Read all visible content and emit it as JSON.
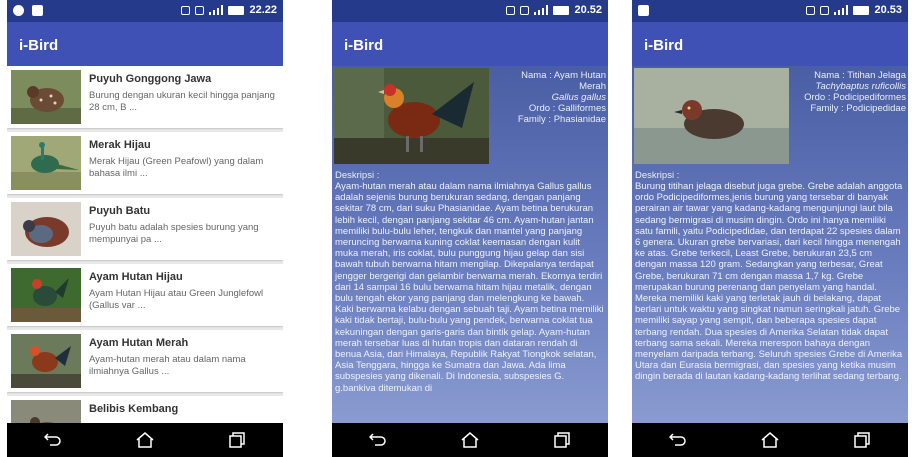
{
  "status": {
    "screen1_time": "22.22",
    "screen2_time": "20.52",
    "screen3_time": "20.53"
  },
  "app": {
    "title": "i-Bird"
  },
  "list": [
    {
      "title": "Puyuh Gonggong Jawa",
      "desc": "Burung dengan ukuran kecil hingga panjang 28 cm, B ..."
    },
    {
      "title": "Merak Hijau",
      "desc": "Merak Hijau (Green Peafowl) yang dalam bahasa ilmi ..."
    },
    {
      "title": "Puyuh Batu",
      "desc": "Puyuh batu adalah spesies burung yang mempunyai pa ..."
    },
    {
      "title": "Ayam Hutan Hijau",
      "desc": "Ayam Hutan Hijau atau Green Junglefowl (Gallus var ..."
    },
    {
      "title": "Ayam Hutan Merah",
      "desc": "Ayam-hutan merah atau dalam nama ilmiahnya Gallus ..."
    },
    {
      "title": "Belibis Kembang",
      "desc": ""
    }
  ],
  "detail_ayam": {
    "nama": "Nama : Ayam Hutan Merah",
    "latin": "Gallus gallus",
    "ordo": "Ordo : Galliformes",
    "family": "Family : Phasianidae",
    "desc_label": "Deskripsi :",
    "desc": "Ayam-hutan merah atau dalam nama ilmiahnya Gallus gallus adalah sejenis burung berukuran sedang, dengan panjang sekitar 78 cm, dari suku Phasianidae. Ayam betina berukuran lebih kecil, dengan panjang sekitar 46 cm. Ayam-hutan jantan memiliki bulu-bulu leher, tengkuk dan mantel yang panjang meruncing berwarna kuning coklat keemasan dengan kulit muka merah, iris coklat, bulu punggung hijau gelap dan sisi bawah tubuh berwarna hitam mengilap. Dikepalanya terdapat jengger bergerigi dan gelambir berwarna merah. Ekornya terdiri dari 14 sampai 16 bulu berwarna hitam hijau metalik, dengan bulu tengah ekor yang panjang dan melengkung ke bawah. Kaki berwarna kelabu dengan sebuah taji. Ayam betina memiliki kaki tidak bertaji, bulu-bulu yang pendek, berwarna coklat tua kekuningan dengan garis-garis dan bintik gelap. Ayam-hutan merah tersebar luas di hutan tropis dan dataran rendah di benua Asia, dari Himalaya, Republik Rakyat Tiongkok selatan, Asia Tenggara, hingga ke Sumatra dan Jawa. Ada lima subspesies yang dikenali. Di Indonesia, subspesies G. g.bankiva ditemukan di"
  },
  "detail_titihan": {
    "nama": "Nama : Titihan Jelaga",
    "latin": "Tachybaptus ruficollis",
    "ordo": "Ordo : Podicipediformes",
    "family": "Family : Podicipedidae",
    "desc_label": "Deskripsi :",
    "desc": "Burung titihan jelaga disebut juga grebe. Grebe adalah anggota ordo Podicipediformes,jenis burung yang tersebar di banyak perairan air tawar yang kadang-kadang mengunjungi laut bila sedang bermigrasi di musim dingin. Ordo ini hanya memiliki satu famili, yaitu Podicipedidae, dan terdapat 22 spesies dalam 6 genera. Ukuran grebe bervariasi, dari kecil hingga menengah ke atas. Grebe terkecil, Least Grebe, berukuran 23,5 cm dengan massa 120 gram. Sedangkan yang terbesar, Great Grebe, berukuran 71 cm dengan massa 1,7 kg. Grebe merupakan burung perenang dan penyelam yang handal. Mereka memiliki kaki yang terletak jauh di belakang, dapat berlari untuk waktu yang singkat namun seringkali jatuh. Grebe memiliki sayap yang sempit, dan beberapa spesies dapat terbang rendah. Dua spesies di Amerika Selatan tidak dapat terbang sama sekali. Mereka merespon bahaya dengan menyelam daripada terbang. Seluruh spesies Grebe di Amerika Utara dan Eurasia bermigrasi, dan spesies yang ketika musim dingin berada di lautan kadang-kadang terlihat sedang terbang."
  },
  "icons": [
    "back-icon",
    "home-icon",
    "recents-icon"
  ]
}
